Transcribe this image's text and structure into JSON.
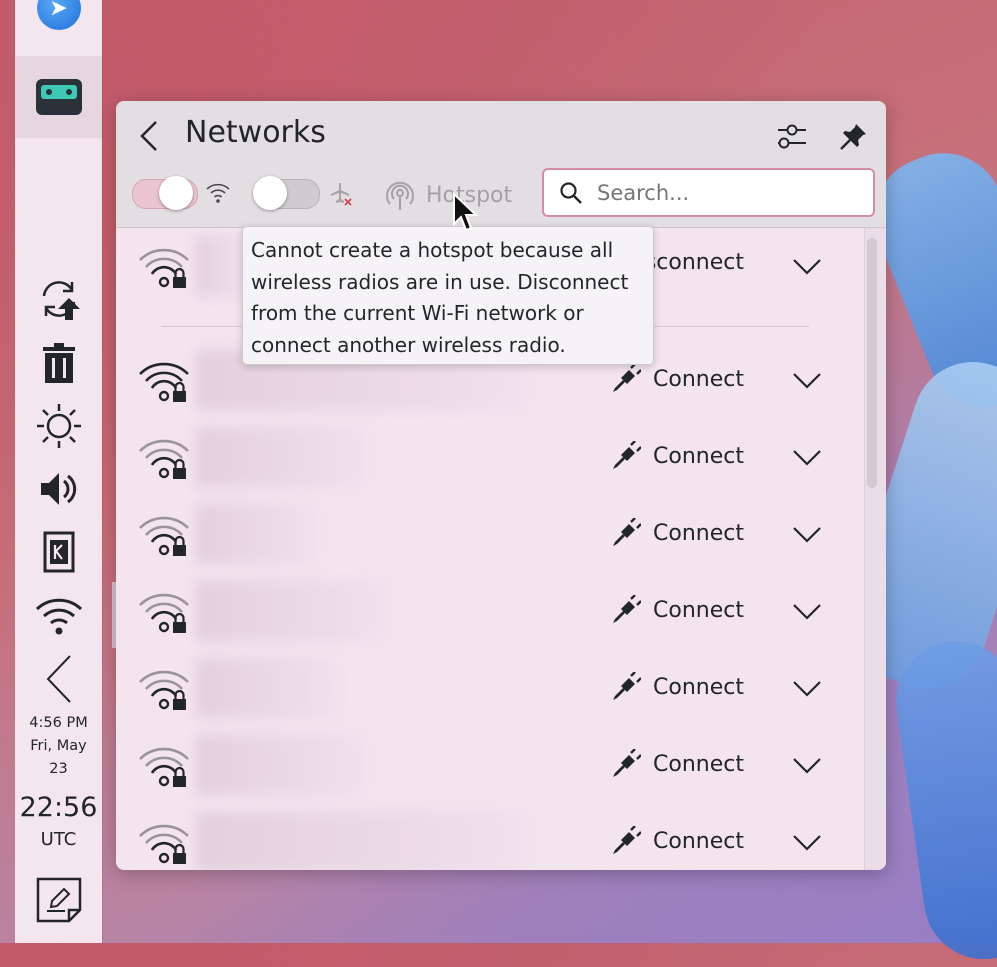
{
  "panel": {
    "tasks": [
      {
        "icon": "app-launcher-icon",
        "active": false
      },
      {
        "icon": "cassette-player-icon",
        "active": true
      }
    ],
    "tray": [
      "update-icon",
      "trash-icon",
      "brightness-icon",
      "volume-icon",
      "kde-connect-icon",
      "wifi-icon",
      "expand-tray-icon"
    ],
    "clock": {
      "time12": "4:56 PM",
      "date_line1": "Fri, May",
      "date_line2": "23",
      "time24": "22:56",
      "timezone": "UTC"
    }
  },
  "networks": {
    "title": "Networks",
    "hotspot_label": "Hotspot",
    "search_placeholder": "Search...",
    "wifi_enabled": true,
    "airplane_mode": false,
    "tooltip": "Cannot create a hotspot because all wireless radios are in use. Disconnect from the current Wi-Fi network or connect another wireless radio.",
    "rows": [
      {
        "action": "Disconnect",
        "connected": true
      },
      {
        "action": "Connect"
      },
      {
        "action": "Connect"
      },
      {
        "action": "Connect"
      },
      {
        "action": "Connect"
      },
      {
        "action": "Connect"
      },
      {
        "action": "Connect"
      },
      {
        "action": "Connect"
      }
    ]
  }
}
